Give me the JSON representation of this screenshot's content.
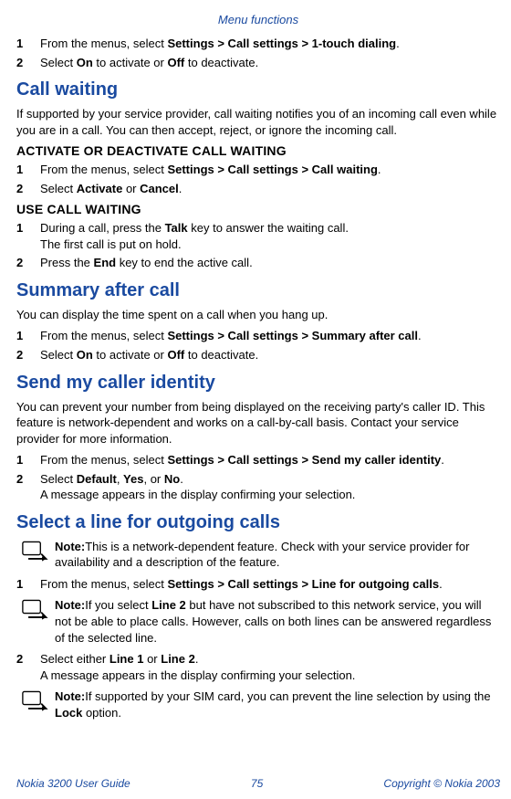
{
  "header": "Menu functions",
  "intro_steps": [
    {
      "num": "1",
      "parts": [
        "From the menus, select ",
        "Settings > Call settings > 1-touch dialing",
        "."
      ]
    },
    {
      "num": "2",
      "parts": [
        "Select ",
        "On",
        " to activate or ",
        "Off",
        " to deactivate."
      ]
    }
  ],
  "sec1": {
    "title": "Call waiting",
    "para": "If supported by your service provider, call waiting notifies you of an incoming call even while you are in a call. You can then accept, reject, or ignore the incoming call.",
    "sub1": "ACTIVATE OR DEACTIVATE CALL WAITING",
    "sub1_steps": [
      {
        "num": "1",
        "parts": [
          "From the menus, select ",
          "Settings > Call settings > Call waiting",
          "."
        ]
      },
      {
        "num": "2",
        "parts": [
          "Select ",
          "Activate",
          " or ",
          "Cancel",
          "."
        ]
      }
    ],
    "sub2": "USE CALL WAITING",
    "sub2_steps": [
      {
        "num": "1",
        "parts": [
          "During a call, press the ",
          "Talk",
          " key to answer the waiting call."
        ],
        "extra": "The first call is put on hold."
      },
      {
        "num": "2",
        "parts": [
          "Press the ",
          "End",
          " key to end the active call."
        ]
      }
    ]
  },
  "sec2": {
    "title": "Summary after call",
    "para": "You can display the time spent on a call when you hang up.",
    "steps": [
      {
        "num": "1",
        "parts": [
          "From the menus, select ",
          "Settings > Call settings > Summary after call",
          "."
        ]
      },
      {
        "num": "2",
        "parts": [
          "Select ",
          "On",
          " to activate or ",
          "Off",
          " to deactivate."
        ]
      }
    ]
  },
  "sec3": {
    "title": "Send my caller identity",
    "para": "You can prevent your number from being displayed on the receiving party's caller ID. This feature is network-dependent and works on a call-by-call basis. Contact your service provider for more information.",
    "steps": [
      {
        "num": "1",
        "parts": [
          "From the menus, select ",
          "Settings > Call settings > Send my caller identity",
          "."
        ]
      },
      {
        "num": "2",
        "parts": [
          "Select ",
          "Default",
          ", ",
          "Yes",
          ", or ",
          "No",
          "."
        ],
        "extra": "A message appears in the display confirming your selection."
      }
    ]
  },
  "sec4": {
    "title": "Select a line for outgoing calls",
    "note1": {
      "label": "Note:",
      "text": "This is a network-dependent feature. Check with your service provider for availability and a description of the feature."
    },
    "step1": {
      "num": "1",
      "parts": [
        "From the menus, select ",
        "Settings > Call settings > Line for outgoing calls",
        "."
      ]
    },
    "note2": {
      "label": "Note:",
      "parts_before": "If you select ",
      "bold1": "Line 2",
      "after": " but have not subscribed to this network service, you will not be able to place calls. However, calls on both lines can be answered regardless of the selected line."
    },
    "step2": {
      "num": "2",
      "parts": [
        "Select either ",
        "Line 1",
        " or ",
        "Line 2",
        "."
      ],
      "extra": "A message appears in the display confirming your selection."
    },
    "note3": {
      "label": "Note:",
      "before": "If supported by your SIM card, you can prevent the line selection by using the ",
      "bold": "Lock",
      "after": " option."
    }
  },
  "footer": {
    "left": "Nokia 3200 User Guide",
    "page": "75",
    "right": "Copyright © Nokia 2003"
  }
}
